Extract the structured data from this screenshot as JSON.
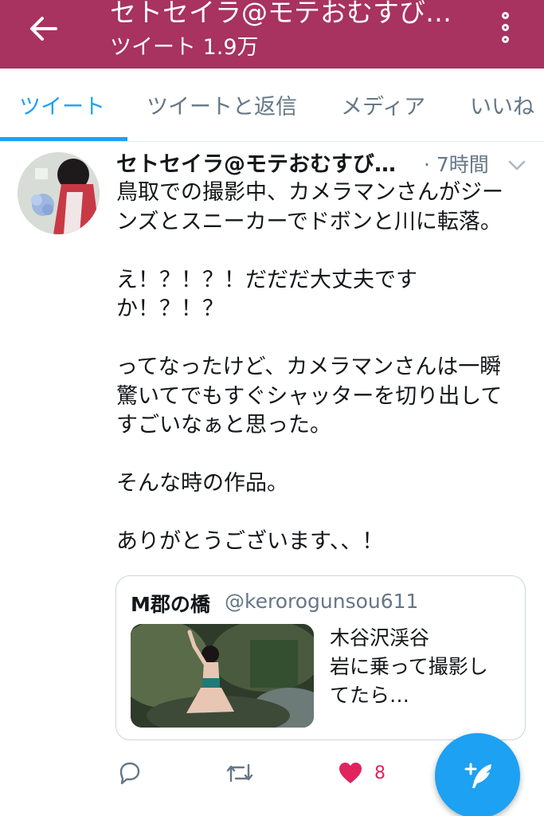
{
  "header": {
    "title": "セトセイラ@モテおむすび…",
    "subtitle": "ツイート 1.9万",
    "accent_color": "#a83260"
  },
  "tabs": [
    {
      "label": "ツイート",
      "active": true
    },
    {
      "label": "ツイートと返信",
      "active": false
    },
    {
      "label": "メディア",
      "active": false
    },
    {
      "label": "いいね",
      "active": false
    }
  ],
  "tweet": {
    "author_name": "セトセイラ@モテおむすび…",
    "time": "· 7時間",
    "lines": [
      "鳥取での撮影中、カメラマンさんがジー",
      "ンズとスニーカーでドボンと川に転落。",
      "",
      "え！？！？！だだだ大丈夫です",
      "か！？！？",
      "",
      "ってなったけど、カメラマンさんは一瞬",
      "驚いてでもすぐシャッターを切り出して",
      "すごいなぁと思った。",
      "",
      "そんな時の作品。",
      "",
      "ありがとうございます、、！"
    ],
    "quote": {
      "name": "M郡の橋",
      "handle": "@kerorogunsou611",
      "text_lines": [
        "木谷沢渓谷",
        "岩に乗って撮影し",
        "てたら…"
      ]
    },
    "actions": {
      "like_count": "8",
      "like_color": "#e0245e"
    }
  },
  "icons": [
    "back-arrow-icon",
    "overflow-menu-icon",
    "chevron-down-icon",
    "reply-icon",
    "retweet-icon",
    "heart-icon",
    "compose-tweet-icon"
  ]
}
